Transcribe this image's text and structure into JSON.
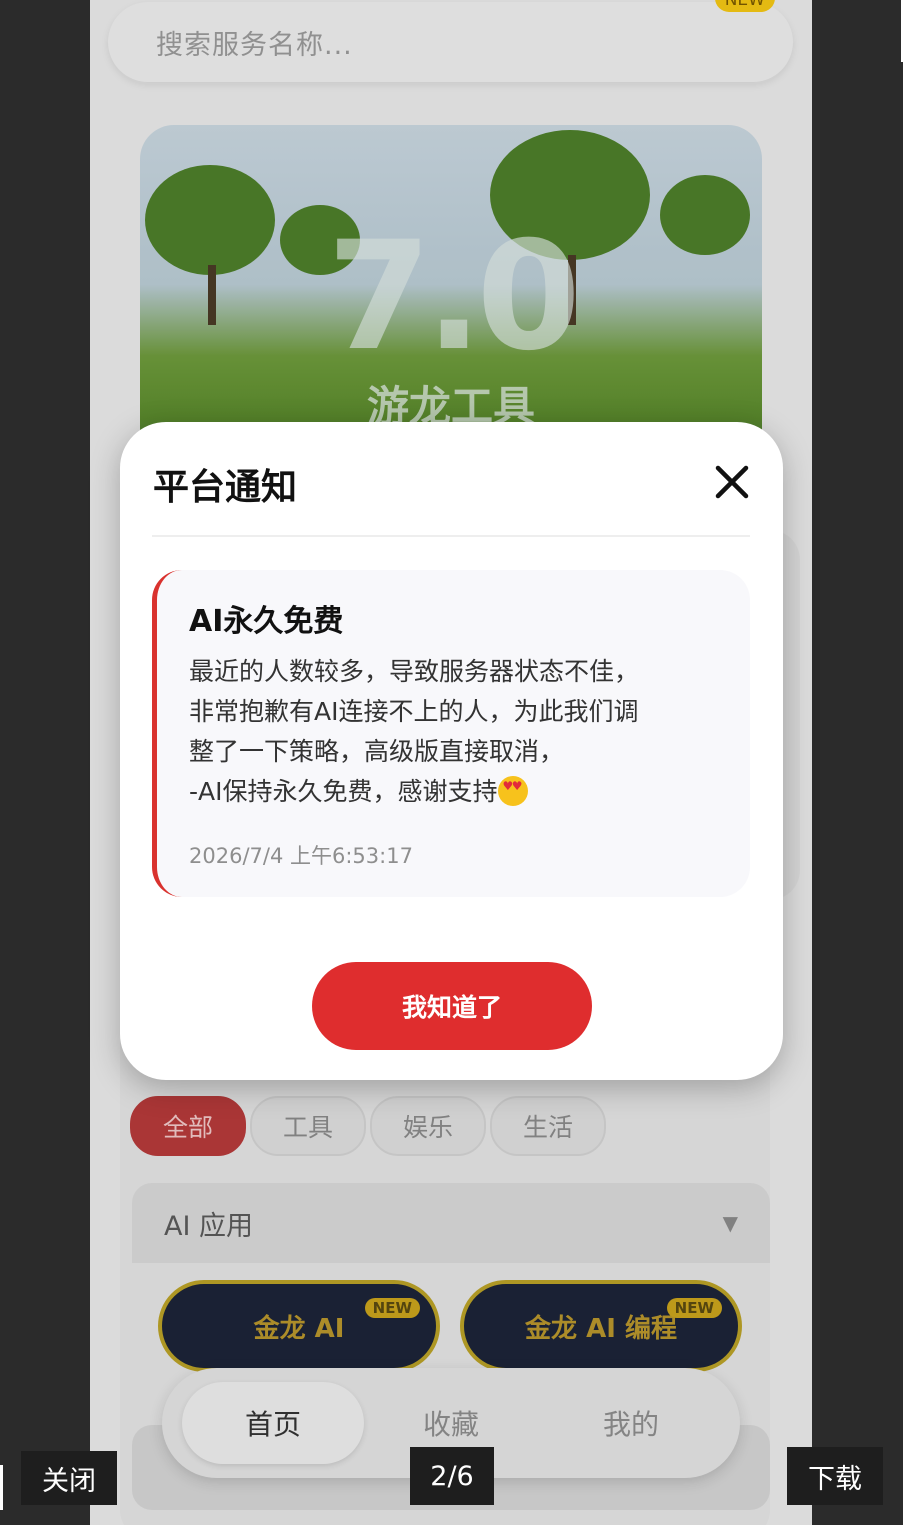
{
  "app": {
    "search_placeholder": "搜索服务名称...",
    "search_badge": "NEW",
    "banner_version": "7.0",
    "banner_title": "游龙工具",
    "chips": [
      "全部",
      "工具",
      "娱乐",
      "生活"
    ],
    "category_label": "AI 应用",
    "category_arrow": "▼",
    "pills": [
      {
        "label": "金龙 AI",
        "badge": "NEW"
      },
      {
        "label": "金龙 AI 编程",
        "badge": "NEW"
      }
    ],
    "nav": [
      "首页",
      "收藏",
      "我的"
    ]
  },
  "modal": {
    "title": "平台通知",
    "notice_title": "AI永久免费",
    "notice_body": "最近的人数较多，导致服务器状态不佳，\n非常抱歉有AI连接不上的人，为此我们调\n整了一下策略，高级版直接取消，\n-AI保持永久免费，感谢支持",
    "notice_time": "2026/7/4 上午6:53:17",
    "ok_label": "我知道了"
  },
  "viewer": {
    "close_label": "关闭",
    "counter": "2/6",
    "download_label": "下载"
  },
  "colors": {
    "accent_red": "#df2d2e",
    "notice_border": "#d9322e",
    "viewer_bg": "#1e1e1e"
  }
}
